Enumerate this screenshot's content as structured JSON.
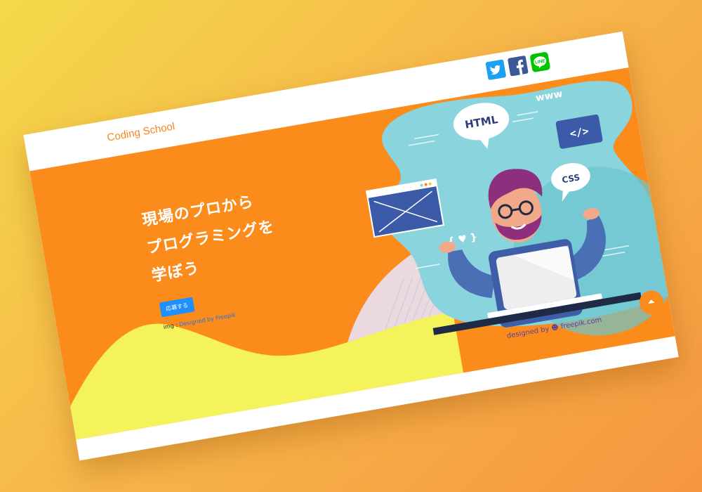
{
  "navbar": {
    "brand": "Coding School",
    "social": [
      {
        "icon": "twitter-icon",
        "color": "#1da1f2"
      },
      {
        "icon": "facebook-icon",
        "color": "#3b5998"
      },
      {
        "icon": "line-icon",
        "color": "#00c300",
        "text": "LINE"
      }
    ]
  },
  "hero": {
    "headline": [
      "現場のプロから",
      "プログラミングを",
      "学ぼう"
    ],
    "cta_label": "応募する",
    "credit_prefix": "img : ",
    "credit_link": "Designed by Freepik",
    "illustration": {
      "bubble_html": "HTML",
      "bubble_css": "CSS",
      "code_tag": "</>",
      "www": "www",
      "heart_braces": "{ ♥ }"
    },
    "designed_by": "designed by ☻ freepik.com"
  },
  "colors": {
    "accent": "#fb8c1c",
    "brand_text": "#f5871f",
    "cta": "#1e90ff",
    "yellow_wave": "#f4f35c",
    "teal": "#7fd3db"
  },
  "scroll_top": {
    "icon": "chevron-up-icon"
  }
}
